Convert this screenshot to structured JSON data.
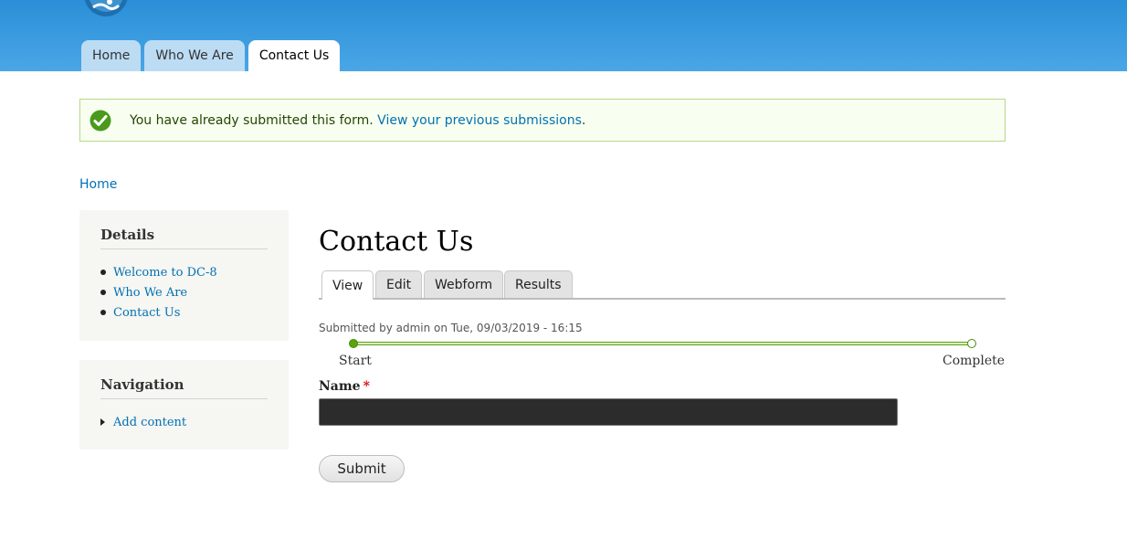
{
  "header": {
    "primary_tabs": [
      {
        "label": "Home"
      },
      {
        "label": "Who We Are"
      },
      {
        "label": "Contact Us"
      }
    ]
  },
  "message": {
    "text": "You have already submitted this form. ",
    "link": "View your previous submissions",
    "end": "."
  },
  "breadcrumb": {
    "label": "Home"
  },
  "sidebar": {
    "details": {
      "title": "Details",
      "items": [
        {
          "label": "Welcome to DC-8"
        },
        {
          "label": "Who We Are"
        },
        {
          "label": "Contact Us"
        }
      ]
    },
    "navigation": {
      "title": "Navigation",
      "items": [
        {
          "label": "Add content"
        }
      ]
    }
  },
  "main": {
    "title": "Contact Us",
    "tabs": [
      {
        "label": "View"
      },
      {
        "label": "Edit"
      },
      {
        "label": "Webform"
      },
      {
        "label": "Results"
      }
    ],
    "submitted": "Submitted by admin on Tue, 09/03/2019 - 16:15",
    "progress": {
      "start": "Start",
      "end": "Complete",
      "fraction_complete": 0.0
    },
    "form": {
      "name_label": "Name",
      "required_mark": "*",
      "name_value": "",
      "submit_label": "Submit"
    }
  },
  "colors": {
    "header": "#2a8fd8",
    "link": "#0071b3",
    "status_ok": "#4a9a1c"
  }
}
